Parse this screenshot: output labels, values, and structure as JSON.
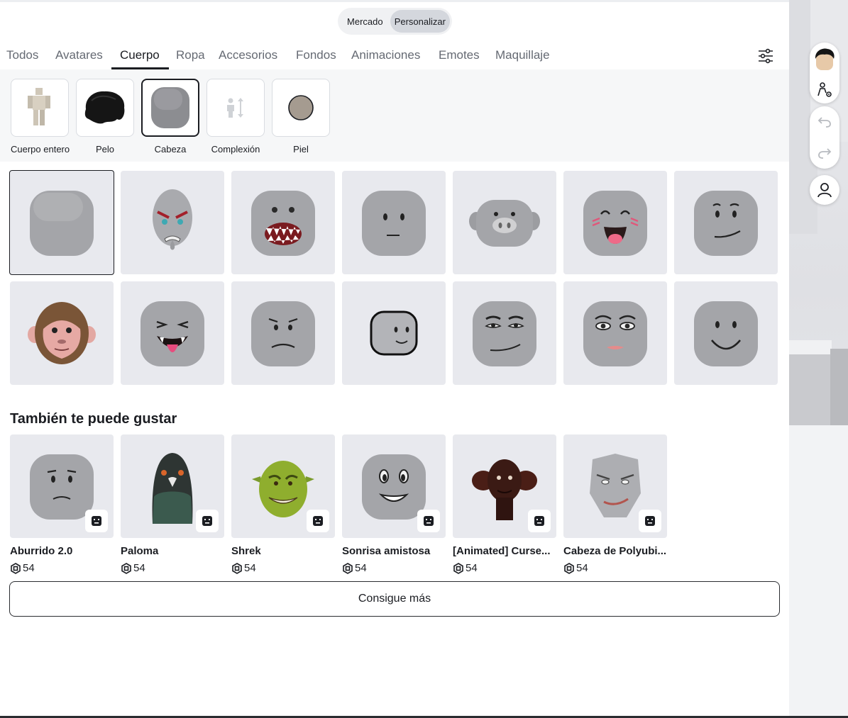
{
  "segment": {
    "market": "Mercado",
    "customize": "Personalizar"
  },
  "tabs": [
    "Todos",
    "Avatares",
    "Cuerpo",
    "Ropa",
    "Accesorios",
    "Fondos",
    "Animaciones",
    "Emotes",
    "Maquillaje"
  ],
  "active_tab": "Cuerpo",
  "subcategories": [
    {
      "label": "Cuerpo entero",
      "icon": "full-body-icon"
    },
    {
      "label": "Pelo",
      "icon": "hair-icon"
    },
    {
      "label": "Cabeza",
      "icon": "head-icon"
    },
    {
      "label": "Complexión",
      "icon": "body-scale-icon"
    },
    {
      "label": "Piel",
      "icon": "skin-tone-icon"
    }
  ],
  "selected_subcategory": "Cabeza",
  "suggest_title": "También te puede gustar",
  "recommendations": [
    {
      "name": "Aburrido 2.0",
      "price": "54"
    },
    {
      "name": "Paloma",
      "price": "54"
    },
    {
      "name": "Shrek",
      "price": "54"
    },
    {
      "name": "Sonrisa amistosa",
      "price": "54"
    },
    {
      "name": "[Animated] Curse...",
      "price": "54"
    },
    {
      "name": "Cabeza de Polyubi...",
      "price": "54"
    }
  ],
  "more_button": "Consigue más",
  "colors": {
    "accent": "#1b1d22",
    "tile": "#e8e9ee",
    "skin": "#a59b90"
  }
}
